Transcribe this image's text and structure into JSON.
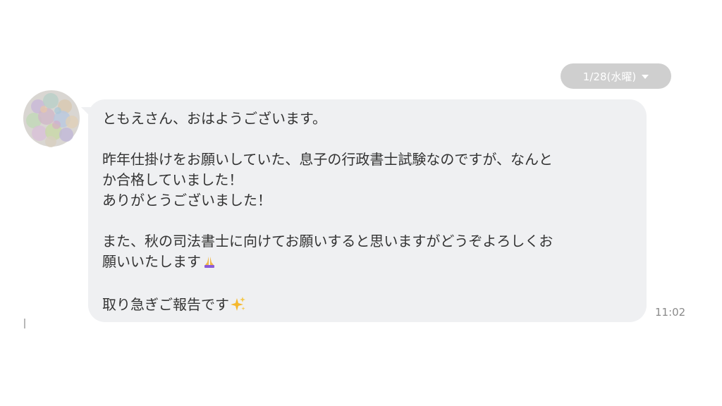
{
  "date_pill": {
    "label": "1/28(水曜)",
    "caret_icon": "chevron-down-icon"
  },
  "message": {
    "line1": "ともえさん、おはようございます。",
    "line2": "昨年仕掛けをお願いしていた、息子の行政書士試験なのですが、なんと",
    "line3": "か合格していました！",
    "line4": "ありがとうございました！",
    "line5": "また、秋の司法書士に向けてお願いすると思いますがどうぞよろしくお",
    "line6": "願いいたします",
    "line7": "取り急ぎご報告です",
    "emoji_pray": "praying-hands-icon",
    "emoji_sparkles": "sparkles-icon",
    "time": "11:02"
  },
  "colors": {
    "bubble": "#eff0f2",
    "date_pill": "#cfcfcf",
    "text": "#333333",
    "timestamp": "#8a8a8a"
  }
}
